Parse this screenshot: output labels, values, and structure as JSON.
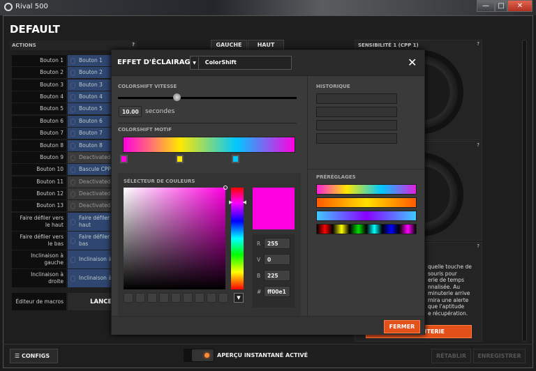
{
  "window": {
    "title": "Rival 500",
    "minimize": "—",
    "maximize": "□",
    "close": "✕"
  },
  "profile": {
    "name": "DEFAULT"
  },
  "actions": {
    "header": "ACTIONS",
    "help": "?",
    "rows": [
      {
        "label": "Bouton 1",
        "value": "Bouton 1",
        "state": "on"
      },
      {
        "label": "Bouton 2",
        "value": "Bouton 2",
        "state": "on"
      },
      {
        "label": "Bouton 3",
        "value": "Bouton 3",
        "state": "on"
      },
      {
        "label": "Bouton 4",
        "value": "Bouton 4",
        "state": "on"
      },
      {
        "label": "Bouton 5",
        "value": "Bouton 5",
        "state": "on"
      },
      {
        "label": "Bouton 6",
        "value": "Bouton 6",
        "state": "on"
      },
      {
        "label": "Bouton 7",
        "value": "Bouton 7",
        "state": "on"
      },
      {
        "label": "Bouton 8",
        "value": "Bouton 8",
        "state": "on"
      },
      {
        "label": "Bouton 9",
        "value": "Deactivated",
        "state": "off"
      },
      {
        "label": "Bouton 10",
        "value": "Bascule CPP",
        "state": "on"
      },
      {
        "label": "Bouton 11",
        "value": "Deactivated",
        "state": "off"
      },
      {
        "label": "Bouton 12",
        "value": "Deactivated",
        "state": "off"
      },
      {
        "label": "Bouton 13",
        "value": "Deactivated",
        "state": "off"
      },
      {
        "label": "Faire défiler vers le haut",
        "value": "Faire défiler vers le haut",
        "state": "on"
      },
      {
        "label": "Faire défiler vers le bas",
        "value": "Faire défiler vers le bas",
        "state": "on"
      },
      {
        "label": "Inclinaison à gauche",
        "value": "Inclinaison à gauche",
        "state": "on"
      },
      {
        "label": "Inclinaison à droite",
        "value": "Inclinaison à droite",
        "state": "on"
      }
    ],
    "macro_label": "Éditeur de macros",
    "macro_button": "LANCER"
  },
  "view_tabs": [
    "GAUCHE",
    "HAUT"
  ],
  "sensitivity": {
    "title": "SENSIBILITÉ 1 (CPP 1)",
    "help": "?"
  },
  "timer_panel": {
    "help": "?",
    "text": [
      "quelle touche de",
      "souris pour",
      "erie de temps",
      "nnalisée. Au",
      "minuterie arrive",
      "rnira une alerte",
      "que l'aptitude",
      "e récupération."
    ],
    "button": "UTERIE"
  },
  "footer": {
    "configs": "CONFIGS",
    "preview": "APERÇU INSTANTANÉ ACTIVÉ",
    "reset": "RÉTABLIR",
    "save": "ENREGISTRER"
  },
  "modal": {
    "title": "EFFET D'ÉCLAIRAGE",
    "effect": "ColorShift",
    "close": "✕",
    "speed_label": "COLORSHIFT VITESSE",
    "speed_value": "10.00",
    "speed_unit": "secondes",
    "speed_fraction": 0.33,
    "pattern_label": "COLORSHIFT MOTIF",
    "stops": [
      {
        "color": "#ff00e1",
        "pos": 0
      },
      {
        "color": "#ffe800",
        "pos": 0.33
      },
      {
        "color": "#00c8ff",
        "pos": 0.66
      }
    ],
    "picker_label": "SÉLECTEUR DE COULEURS",
    "r_label": "R",
    "r": "255",
    "g_label": "V",
    "g": "0",
    "b_label": "B",
    "b": "225",
    "hex_label": "#",
    "hex": "ff00e1",
    "selected_color": "#ff00e1",
    "history_label": "HISTORIQUE",
    "presets_label": "PRÉRÉGLAGES",
    "close_button": "FERMER"
  }
}
